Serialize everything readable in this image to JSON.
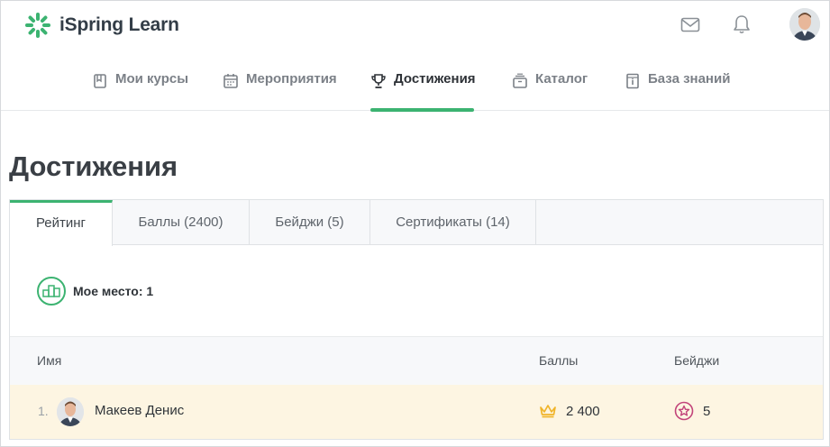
{
  "app": {
    "name": "iSpring Learn"
  },
  "nav": {
    "items": [
      {
        "label": "Мои курсы",
        "icon": "book-icon"
      },
      {
        "label": "Мероприятия",
        "icon": "calendar-icon"
      },
      {
        "label": "Достижения",
        "icon": "trophy-icon",
        "active": true
      },
      {
        "label": "Каталог",
        "icon": "catalog-icon"
      },
      {
        "label": "База знаний",
        "icon": "knowledge-base-icon"
      }
    ]
  },
  "page": {
    "title": "Достижения"
  },
  "tabs": [
    {
      "label": "Рейтинг",
      "active": true
    },
    {
      "label": "Баллы (2400)"
    },
    {
      "label": "Бейджи (5)"
    },
    {
      "label": "Сертификаты (14)"
    }
  ],
  "my_place": {
    "label": "Мое место: 1"
  },
  "table": {
    "columns": {
      "name": "Имя",
      "points": "Баллы",
      "badges": "Бейджи"
    },
    "rows": [
      {
        "rank": "1.",
        "name": "Макеев Денис",
        "points": "2 400",
        "badges": "5"
      }
    ]
  },
  "colors": {
    "accent": "#3cb371",
    "highlight_row": "#fdf5e2",
    "crown": "#f0b429",
    "badge": "#c2447a"
  }
}
